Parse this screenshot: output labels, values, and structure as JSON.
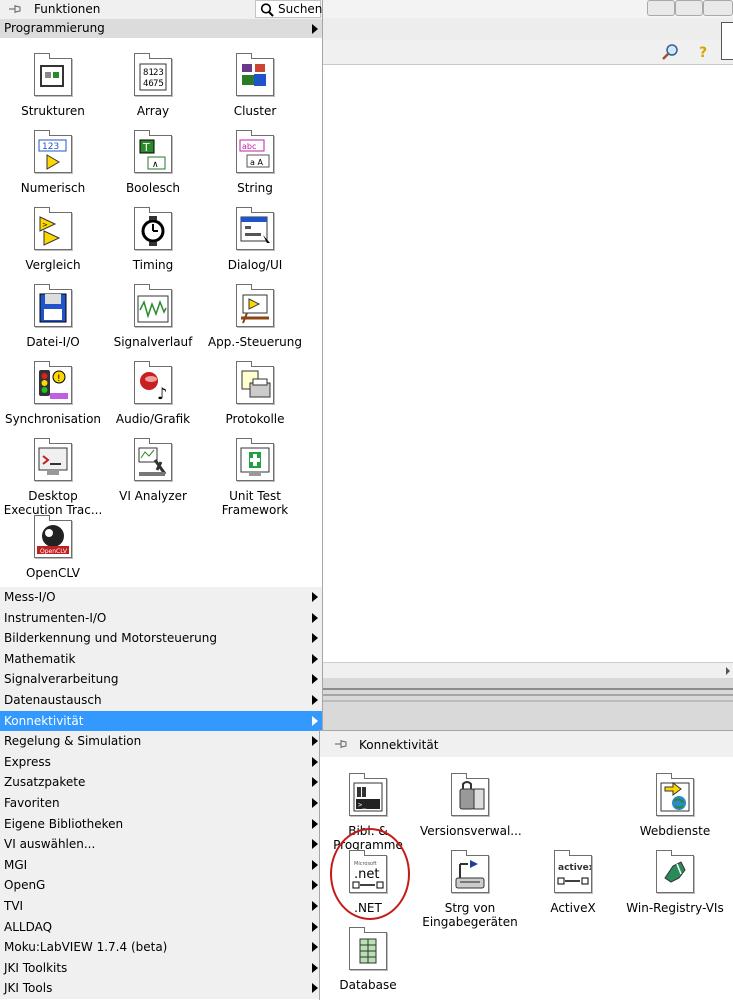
{
  "palette": {
    "title": "Funktionen",
    "search_label": "Suchen",
    "category": "Programmierung",
    "icons": [
      {
        "label": "Strukturen",
        "icon": "structures-icon"
      },
      {
        "label": "Array",
        "icon": "array-icon"
      },
      {
        "label": "Cluster",
        "icon": "cluster-icon"
      },
      {
        "label": "Numerisch",
        "icon": "numeric-icon"
      },
      {
        "label": "Boolesch",
        "icon": "boolean-icon"
      },
      {
        "label": "String",
        "icon": "string-icon"
      },
      {
        "label": "Vergleich",
        "icon": "comparison-icon"
      },
      {
        "label": "Timing",
        "icon": "timing-icon"
      },
      {
        "label": "Dialog/UI",
        "icon": "dialog-ui-icon"
      },
      {
        "label": "Datei-I/O",
        "icon": "file-io-icon"
      },
      {
        "label": "Signalverlauf",
        "icon": "waveform-icon"
      },
      {
        "label": "App.-Steuerung",
        "icon": "app-control-icon"
      },
      {
        "label": "Synchronisation",
        "icon": "synchronization-icon"
      },
      {
        "label": "Audio/Grafik",
        "icon": "audio-graphics-icon"
      },
      {
        "label": "Protokolle",
        "icon": "report-icon"
      },
      {
        "label": "Desktop Execution Trac...",
        "icon": "desktop-execution-trace-icon"
      },
      {
        "label": "VI Analyzer",
        "icon": "vi-analyzer-icon"
      },
      {
        "label": "Unit Test Framework",
        "icon": "unit-test-icon"
      },
      {
        "label": "OpenCLV",
        "icon": "openclv-icon"
      }
    ],
    "menu_items": [
      {
        "label": "Mess-I/O"
      },
      {
        "label": "Instrumenten-I/O"
      },
      {
        "label": "Bilderkennung und Motorsteuerung"
      },
      {
        "label": "Mathematik"
      },
      {
        "label": "Signalverarbeitung"
      },
      {
        "label": "Datenaustausch"
      },
      {
        "label": "Konnektivität",
        "selected": true
      },
      {
        "label": "Regelung & Simulation"
      },
      {
        "label": "Express"
      },
      {
        "label": "Zusatzpakete"
      },
      {
        "label": "Favoriten"
      },
      {
        "label": "Eigene Bibliotheken"
      },
      {
        "label": "VI auswählen..."
      },
      {
        "label": "MGI"
      },
      {
        "label": "OpenG"
      },
      {
        "label": "TVI"
      },
      {
        "label": "ALLDAQ"
      },
      {
        "label": "Moku:LabVIEW 1.7.4 (beta)"
      },
      {
        "label": "JKI Toolkits"
      },
      {
        "label": "JKI Tools"
      }
    ]
  },
  "subpalette": {
    "title": "Konnektivität",
    "icons": [
      {
        "label": "Bibl. & Programme",
        "icon": "libraries-executables-icon"
      },
      {
        "label": "Versionsverwal...",
        "icon": "source-control-icon"
      },
      {
        "label": "Webdienste",
        "icon": "web-services-icon"
      },
      {
        "label": ".NET",
        "icon": "dotnet-icon",
        "icon_text": ".net"
      },
      {
        "label": "Strg von Eingabegeräten",
        "icon": "input-device-control-icon"
      },
      {
        "label": "ActiveX",
        "icon": "activex-icon",
        "icon_text": "activex"
      },
      {
        "label": "Win-Registry-VIs",
        "icon": "windows-registry-icon"
      },
      {
        "label": "Database",
        "icon": "database-icon"
      }
    ]
  },
  "colors": {
    "selection": "#3399ff",
    "highlight_circle": "#c41a1a"
  }
}
